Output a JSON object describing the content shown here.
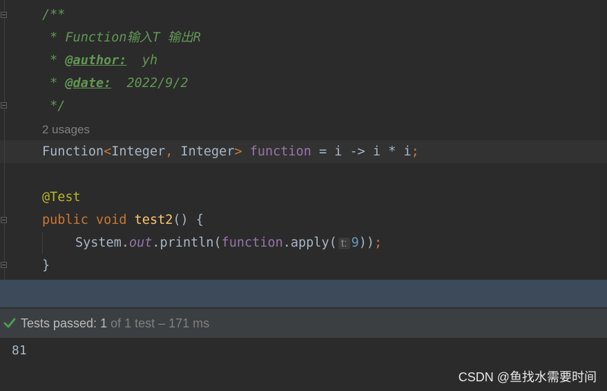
{
  "code": {
    "doc_open": "/**",
    "doc_line1": " * Function输入T 输出R",
    "author_prefix": " * ",
    "author_tag": "@author:",
    "author_value": "  yh",
    "date_prefix": " * ",
    "date_tag": "@date:",
    "date_value": "  2022/9/2",
    "doc_close": " */",
    "usages": "2 usages",
    "decl_type": "Function",
    "decl_lt": "<",
    "decl_t1": "Integer",
    "decl_comma": ",",
    "decl_t2": " Integer",
    "decl_gt": ">",
    "decl_name": " function",
    "decl_rest": " = i -> i * i",
    "decl_semi": ";",
    "annotation": "@Test",
    "kw_public": "public",
    "kw_void": " void",
    "method_name": " test2",
    "method_rest": "() {",
    "call_system": "System.",
    "call_out": "out",
    "call_println": ".println(",
    "call_function": "function",
    "call_apply": ".apply(",
    "param_hint": "t:",
    "arg_value": "9",
    "call_end": "))",
    "call_semi": ";",
    "close_brace": "}"
  },
  "test_status": {
    "passed_label": "Tests passed: ",
    "passed_count": "1",
    "summary": " of 1 test – 171 ms",
    "icon": "check-icon"
  },
  "console": {
    "output": "81"
  },
  "watermark": "CSDN @鱼找水需要时间",
  "colors": {
    "background": "#2b2b2b",
    "doc_comment": "#629755",
    "keyword": "#cc7832",
    "field": "#9876aa",
    "annotation": "#bbb529",
    "method": "#ffc66d",
    "number": "#6897bb",
    "success": "#499c54"
  }
}
